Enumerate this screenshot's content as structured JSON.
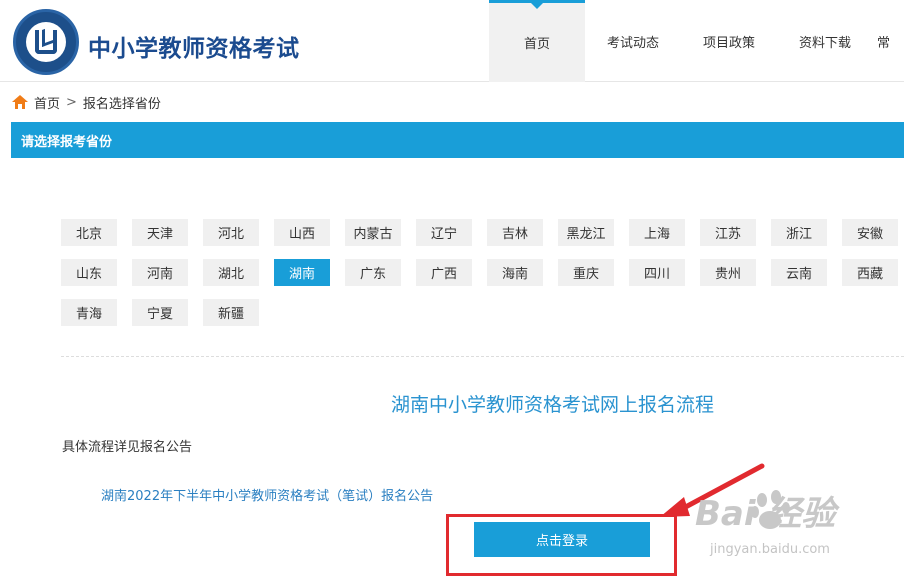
{
  "header": {
    "site_title": "中小学教师资格考试",
    "nav": [
      {
        "label": "首页",
        "active": true
      },
      {
        "label": "考试动态"
      },
      {
        "label": "项目政策"
      },
      {
        "label": "资料下载"
      },
      {
        "label": "常"
      }
    ]
  },
  "breadcrumb": {
    "home": "首页",
    "separator": ">",
    "current": "报名选择省份"
  },
  "section": {
    "title": "请选择报考省份"
  },
  "provinces": {
    "selected": "湖南",
    "items": [
      "北京",
      "天津",
      "河北",
      "山西",
      "内蒙古",
      "辽宁",
      "吉林",
      "黑龙江",
      "上海",
      "江苏",
      "浙江",
      "安徽",
      "山东",
      "河南",
      "湖北",
      "湖南",
      "广东",
      "广西",
      "海南",
      "重庆",
      "四川",
      "贵州",
      "云南",
      "西藏",
      "青海",
      "宁夏",
      "新疆"
    ]
  },
  "process": {
    "title": "湖南中小学教师资格考试网上报名流程",
    "detail": "具体流程详见报名公告",
    "notice_link": "湖南2022年下半年中小学教师资格考试（笔试）报名公告",
    "login_button": "点击登录"
  },
  "watermark": {
    "main": "Bai  经验",
    "sub": "jingyan.baidu.com"
  },
  "colors": {
    "accent": "#199ed8",
    "title_blue": "#1b4b8f",
    "annotation_red": "#e12a2f",
    "home_orange": "#f07c17"
  }
}
